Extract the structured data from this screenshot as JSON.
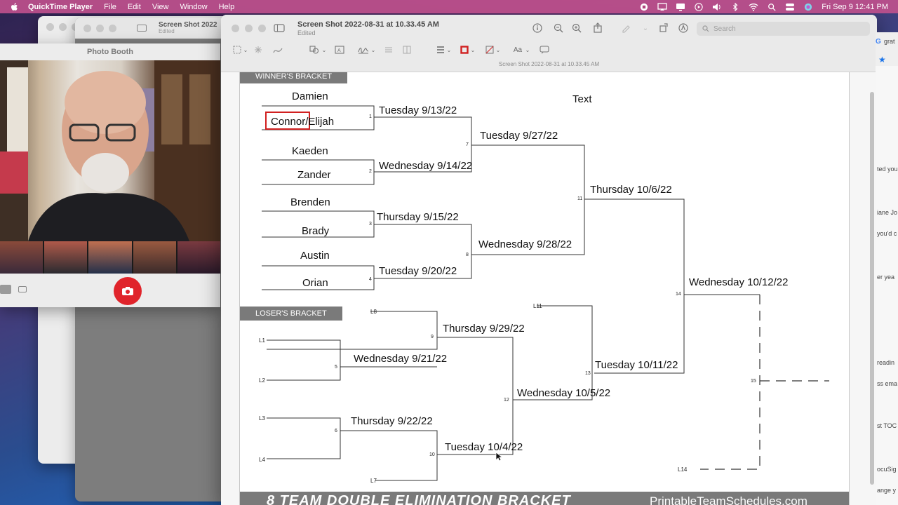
{
  "menubar": {
    "app_name": "QuickTime Player",
    "menus": [
      "File",
      "Edit",
      "View",
      "Window",
      "Help"
    ],
    "datetime": "Fri Sep 9  12:41 PM"
  },
  "background_window": {
    "title": "Screen Shot 2022",
    "subtitle": "Edited"
  },
  "photo_booth": {
    "title": "Photo Booth"
  },
  "preview": {
    "title": "Screen Shot 2022-08-31 at 10.33.45 AM",
    "subtitle": "Edited",
    "search_placeholder": "Search",
    "doc_name": "Screen Shot 2022-08-31 at 10.33.45 AM"
  },
  "bracket": {
    "winners_label": "WINNER'S BRACKET",
    "losers_label": "LOSER'S BRACKET",
    "annotation_text": "Text",
    "teams": [
      "Damien",
      "Connor/Elijah",
      "Kaeden",
      "Zander",
      "Brenden",
      "Brady",
      "Austin",
      "Orian"
    ],
    "dates": {
      "g1": "Tuesday 9/13/22",
      "g2": "Wednesday 9/14/22",
      "g3": "Thursday 9/15/22",
      "g4": "Tuesday 9/20/22",
      "g7": "Tuesday 9/27/22",
      "g8": "Wednesday 9/28/22",
      "g11": "Thursday 10/6/22",
      "g14": "Wednesday 10/12/22",
      "g9": "Thursday 9/29/22",
      "g5": "Wednesday 9/21/22",
      "g6": "Thursday 9/22/22",
      "g10": "Tuesday 10/4/22",
      "g12": "Wednesday 10/5/22",
      "g13": "Tuesday 10/11/22"
    },
    "game_numbers": [
      "1",
      "2",
      "3",
      "4",
      "5",
      "6",
      "7",
      "8",
      "9",
      "10",
      "11",
      "12",
      "13",
      "14",
      "15"
    ],
    "loser_labels": [
      "L1",
      "L2",
      "L3",
      "L4",
      "L7",
      "L8",
      "L11",
      "L14"
    ],
    "footer_title": "8 TEAM DOUBLE ELIMINATION BRACKET",
    "footer_site": "PrintableTeamSchedules.com"
  },
  "side_window": {
    "fragments": [
      "grat",
      "ted you",
      "iane Jo",
      "you'd c",
      "er yea",
      "readin",
      "ss ema",
      "st TOC",
      "ocuSig",
      "ange y"
    ]
  }
}
